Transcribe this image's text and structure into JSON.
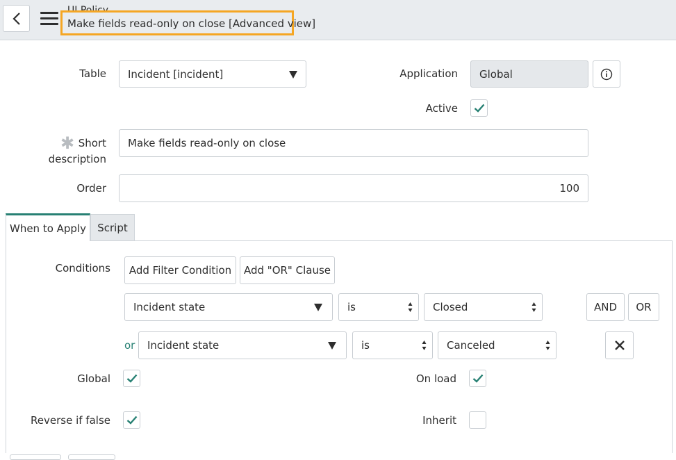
{
  "header": {
    "record_type": "UI Policy",
    "record_title": "Make fields read-only on close [Advanced view]"
  },
  "form": {
    "table_label": "Table",
    "table_value": "Incident [incident]",
    "application_label": "Application",
    "application_value": "Global",
    "active_label": "Active",
    "active_checked": true,
    "short_desc_label_1": "Short",
    "short_desc_label_2": "description",
    "short_desc_value": "Make fields read-only on close",
    "order_label": "Order",
    "order_value": "100"
  },
  "tabs": [
    {
      "label": "When to Apply",
      "active": true
    },
    {
      "label": "Script",
      "active": false
    }
  ],
  "conditions": {
    "label": "Conditions",
    "add_filter_label": "Add Filter Condition",
    "add_or_label": "Add \"OR\" Clause",
    "rows": [
      {
        "prefix": "",
        "field": "Incident state",
        "operator": "is",
        "value": "Closed"
      },
      {
        "prefix": "or",
        "field": "Incident state",
        "operator": "is",
        "value": "Canceled"
      }
    ],
    "and_label": "AND",
    "or_label": "OR"
  },
  "options": {
    "global_label": "Global",
    "global_checked": true,
    "on_load_label": "On load",
    "on_load_checked": true,
    "reverse_label": "Reverse if false",
    "reverse_checked": true,
    "inherit_label": "Inherit",
    "inherit_checked": false
  },
  "colors": {
    "highlight_border": "#f5a623",
    "tab_accent": "#278073",
    "check": "#278073",
    "or_text": "#278073"
  }
}
